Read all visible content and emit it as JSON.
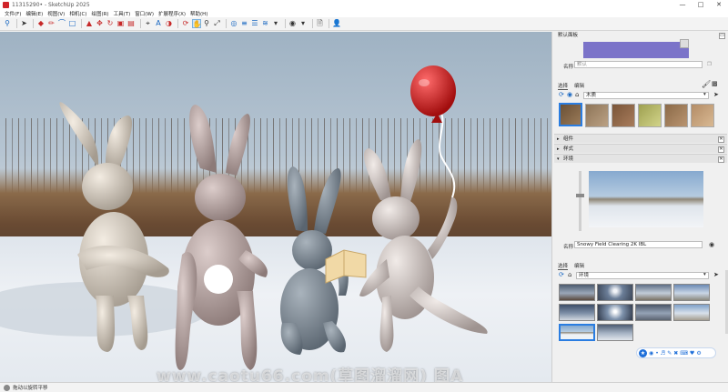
{
  "window": {
    "title": "11315290• - SketchUp 2025",
    "controls": [
      "—",
      "□",
      "✕"
    ]
  },
  "menu": [
    "文件(F)",
    "编辑(E)",
    "视图(V)",
    "相机(C)",
    "绘图(R)",
    "工具(T)",
    "窗口(W)",
    "扩展程序(X)",
    "帮助(H)"
  ],
  "toolbar": {
    "icons": [
      "search-icon",
      "select-icon",
      "eraser-icon",
      "line-icon",
      "arc-icon",
      "rectangle-icon",
      "push-pull-icon",
      "move-icon",
      "rotate-icon",
      "scale-icon",
      "offset-icon",
      "tape-icon",
      "text-icon",
      "paint-icon",
      "orbit-icon",
      "pan-icon",
      "zoom-icon",
      "zoom-extents-icon",
      "section-icon",
      "styles-icon",
      "layers-icon",
      "more-icon",
      "scenes-icon",
      "model-icon",
      "export-icon",
      "user-icon"
    ]
  },
  "viewport": {
    "watermark": "www.caotu66.com(草图溜溜网) 图A"
  },
  "panel": {
    "title": "默认面板",
    "material_name_label": "名称",
    "material_name_placeholder": "默认",
    "materials_tabs": [
      "选择",
      "编辑"
    ],
    "materials_category": "木质",
    "sections": {
      "components": "组件",
      "styles": "样式",
      "environments": "环境"
    },
    "env_name_label": "名称",
    "env_name_value": "Snowy Field Clearing 2K IBL",
    "env_tabs": [
      "选择",
      "编辑"
    ],
    "env_category": "环境"
  },
  "colors": {
    "balloon": "#d01818",
    "wood": "#8a6a48",
    "accent": "#1e6fd9"
  },
  "status": {
    "text": "拖动以旋转平移"
  }
}
